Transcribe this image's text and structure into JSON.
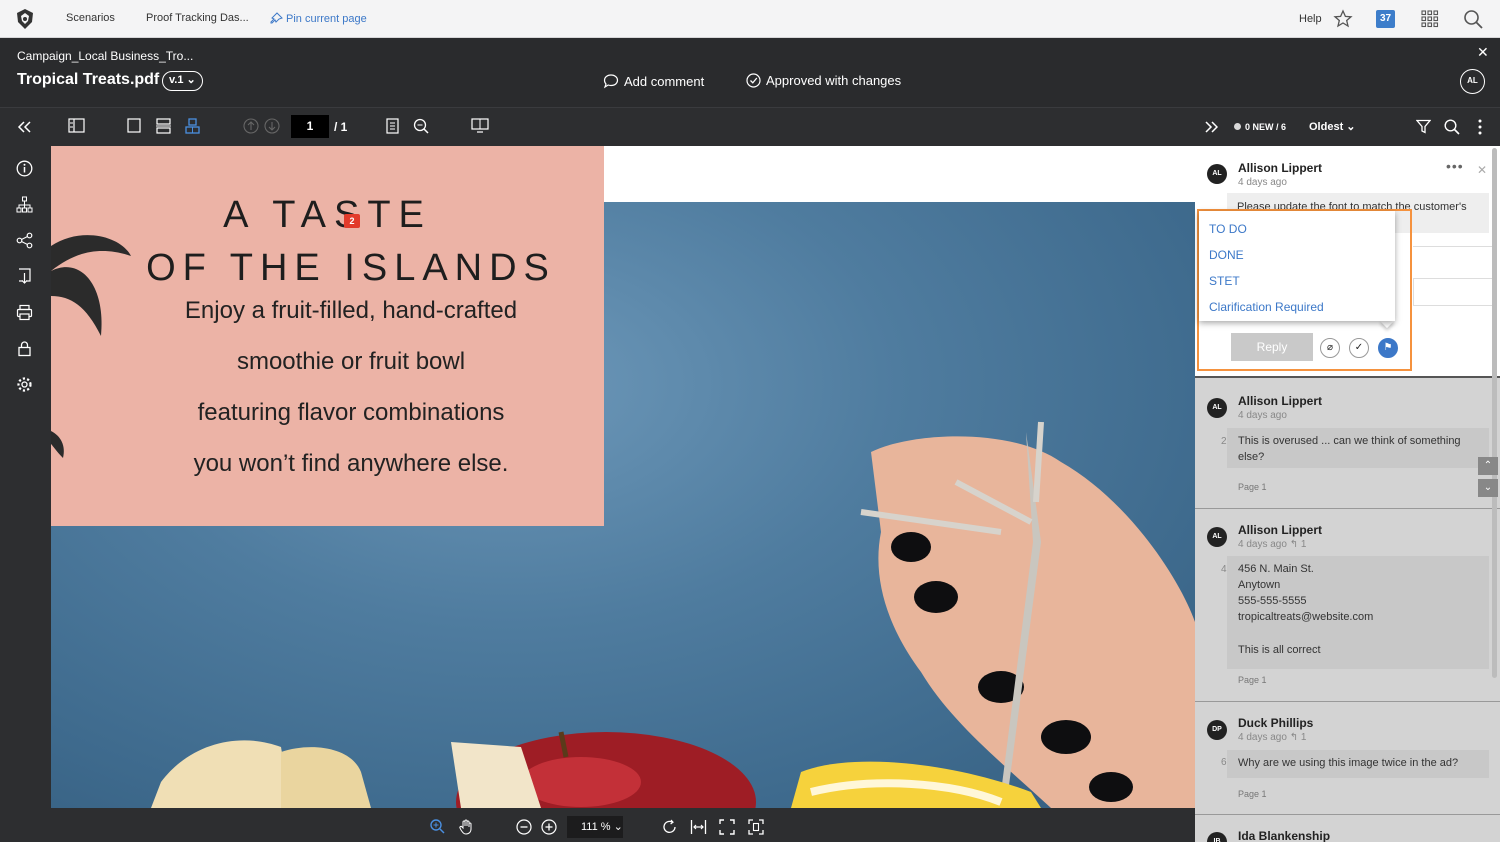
{
  "topnav": {
    "crumbs": [
      "Scenarios",
      "Proof Tracking Das..."
    ],
    "pin_label": "Pin current page",
    "help_label": "Help",
    "notification_count": "37"
  },
  "doc": {
    "campaign": "Campaign_Local Business_Tro...",
    "filename": "Tropical Treats.pdf",
    "version": "v.1",
    "add_comment": "Add comment",
    "approval_status": "Approved with changes",
    "user_initials": "AL"
  },
  "toolbar": {
    "page_current": "1",
    "page_total": "/ 1"
  },
  "canvas": {
    "headline1": "A TASTE",
    "headline2": "OF THE ISLANDS",
    "body_lines": [
      "Enjoy a fruit-filled, hand-crafted",
      "smoothie or fruit bowl",
      "featuring flavor combinations",
      "you won’t find anywhere else."
    ],
    "pin_number": "2"
  },
  "zoom": {
    "value": "111 %"
  },
  "panel": {
    "new_count": "0 NEW / 6",
    "sort": "Oldest",
    "active_comment": {
      "initials": "AL",
      "author": "Allison Lippert",
      "time": "4 days ago",
      "text": "Please update the font to match the customer's",
      "status_options": [
        "TO DO",
        "DONE",
        "STET",
        "Clarification Required"
      ],
      "reply_label": "Reply"
    },
    "comments": [
      {
        "initials": "AL",
        "author": "Allison Lippert",
        "time": "4 days ago",
        "replies": "",
        "number": "2",
        "text_lines": [
          "This is overused ... can we think of something",
          "else?"
        ],
        "page": "Page 1"
      },
      {
        "initials": "AL",
        "author": "Allison Lippert",
        "time": "4 days ago",
        "replies": "1",
        "number": "4",
        "text_lines": [
          "456 N. Main St.",
          "Anytown",
          "555-555-5555",
          "tropicaltreats@website.com",
          "",
          "This is all correct"
        ],
        "page": "Page 1"
      },
      {
        "initials": "DP",
        "author": "Duck Phillips",
        "time": "4 days ago",
        "replies": "1",
        "number": "6",
        "text_lines": [
          "Why are we using this image twice in the ad?"
        ],
        "page": "Page 1"
      },
      {
        "initials": "IB",
        "author": "Ida Blankenship",
        "time": "",
        "replies": "",
        "number": "",
        "text_lines": [],
        "page": ""
      }
    ]
  },
  "colors": {
    "accent": "#3c78c8",
    "highlight": "#f5923e",
    "pin": "#e23b2b",
    "pink_panel": "#ecb3a6"
  }
}
